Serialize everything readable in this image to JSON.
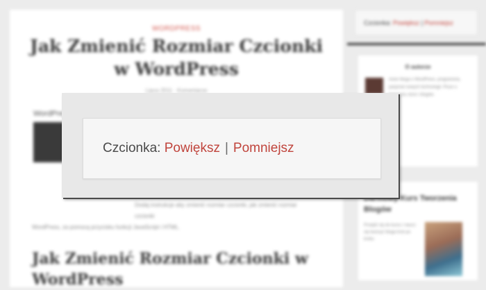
{
  "article": {
    "category": "WORDPRESS",
    "title": "Jak Zmienić Rozmiar Czcionki w WordPress",
    "meta": "Lipca 2011 · Komentarze",
    "lead_label": "WordPress",
    "paragraph_1": "Dodaj instrukcje aby zmienić rozmiar czcionki, jak zmienić rozmiar czcionki",
    "paragraph_2": "WordPress, za pomocą przycisku funkcji JavaScript i HTML.",
    "subheading": "Jak Zmienić Rozmiar Czcionki w WordPress"
  },
  "sidebar": {
    "font_label": "Czcionka:",
    "enlarge": "Powiększ",
    "separator": "|",
    "shrink": "Pomniejsz",
    "author_title": "O autorze",
    "author_text": "Autor bloga o WordPress, programista, pasjonat nowych technologii. Pisze o tworzeniu stron i blogów.",
    "course_title": "Darmowy Kurs Tworzenia Blogów",
    "course_text": "Przejdź się do kursu i naucz się tworzyć bloga krok po kroku"
  },
  "popup": {
    "font_label": "Czcionka:",
    "enlarge": "Powiększ",
    "separator": "|",
    "shrink": "Pomniejsz"
  },
  "colors": {
    "link": "#c0443c",
    "background": "#ececec"
  }
}
